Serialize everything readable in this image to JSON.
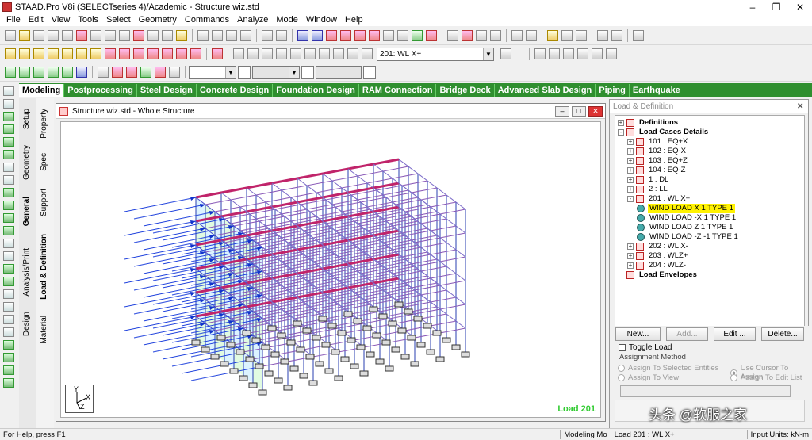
{
  "window": {
    "title": "STAAD.Pro V8i (SELECTseries 4)/Academic - Structure wiz.std"
  },
  "menu": [
    "File",
    "Edit",
    "View",
    "Tools",
    "Select",
    "Geometry",
    "Commands",
    "Analyze",
    "Mode",
    "Window",
    "Help"
  ],
  "toolbar": {
    "load_combo": "201: WL X+"
  },
  "page_tabs": [
    {
      "label": "Modeling",
      "active": true
    },
    {
      "label": "Postprocessing"
    },
    {
      "label": "Steel Design"
    },
    {
      "label": "Concrete Design"
    },
    {
      "label": "Foundation Design"
    },
    {
      "label": "RAM Connection"
    },
    {
      "label": "Bridge Deck"
    },
    {
      "label": "Advanced Slab Design"
    },
    {
      "label": "Piping"
    },
    {
      "label": "Earthquake"
    }
  ],
  "vertical_tabs": {
    "col1": [
      "Setup",
      "Geometry",
      "General",
      "Analysis/Print",
      "Design"
    ],
    "col2": [
      "Property",
      "Spec",
      "Support",
      "Load & Definition",
      "Material"
    ]
  },
  "view_window": {
    "title": "Structure wiz.std - Whole Structure",
    "load_label": "Load 201",
    "axis": {
      "y": "Y",
      "x": "X",
      "z": "Z"
    }
  },
  "panel": {
    "title": "Load & Definition",
    "tree": [
      {
        "label": "Definitions",
        "bold": true,
        "level": 0,
        "pm": "+"
      },
      {
        "label": "Load Cases Details",
        "bold": true,
        "level": 0,
        "pm": "-"
      },
      {
        "label": "101 : EQ+X",
        "level": 1,
        "pm": "+"
      },
      {
        "label": "102 : EQ-X",
        "level": 1,
        "pm": "+"
      },
      {
        "label": "103 : EQ+Z",
        "level": 1,
        "pm": "+"
      },
      {
        "label": "104 : EQ-Z",
        "level": 1,
        "pm": "+"
      },
      {
        "label": "1 : DL",
        "level": 1,
        "pm": "+"
      },
      {
        "label": "2 : LL",
        "level": 1,
        "pm": "+"
      },
      {
        "label": "201 : WL X+",
        "level": 1,
        "pm": "-"
      },
      {
        "label": "WIND LOAD X 1 TYPE 1",
        "level": 2,
        "highlight": true
      },
      {
        "label": "WIND LOAD -X 1 TYPE 1",
        "level": 2
      },
      {
        "label": "WIND LOAD Z 1 TYPE 1",
        "level": 2
      },
      {
        "label": "WIND LOAD -Z -1 TYPE 1",
        "level": 2
      },
      {
        "label": "202 : WL X-",
        "level": 1,
        "pm": "+"
      },
      {
        "label": "203 : WLZ+",
        "level": 1,
        "pm": "+"
      },
      {
        "label": "204 : WLZ-",
        "level": 1,
        "pm": "+"
      },
      {
        "label": "Load Envelopes",
        "bold": true,
        "level": 0
      }
    ],
    "buttons": {
      "new": "New...",
      "add": "Add...",
      "edit": "Edit ...",
      "delete": "Delete..."
    },
    "toggle_load": "Toggle Load",
    "assignment_method": "Assignment Method",
    "options": {
      "assign_selected": "Assign To Selected Entities",
      "use_cursor": "Use Cursor To Assign",
      "assign_view": "Assign To View",
      "assign_edit": "Assign To Edit List"
    }
  },
  "status": {
    "help": "For Help, press F1",
    "mode": "Modeling Mo",
    "load": "Load 201 : WL X+",
    "units": "Input Units:  kN-m"
  },
  "watermark": "头条 @软服之家"
}
